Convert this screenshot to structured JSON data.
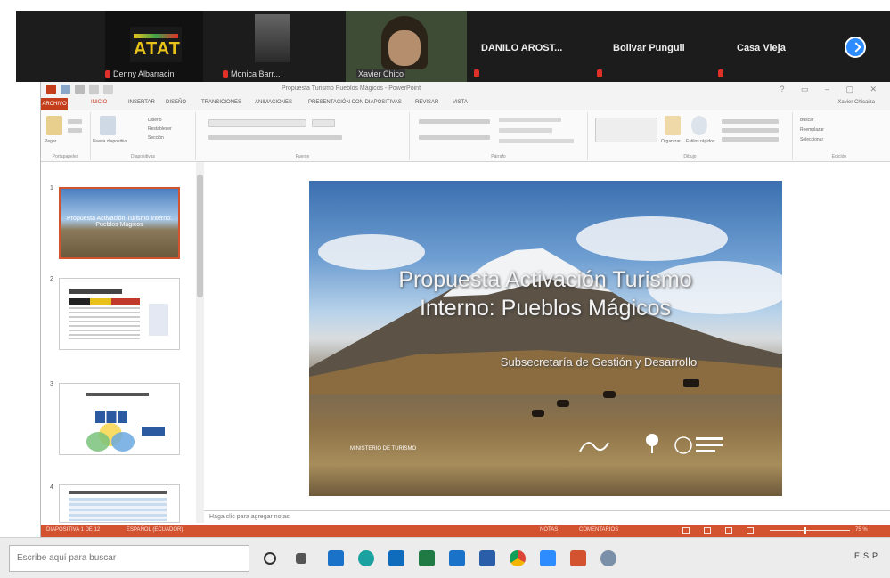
{
  "zoom": {
    "participants": [
      {
        "name": "Denny Albarracin",
        "kind": "logo"
      },
      {
        "name": "Monica Barr...",
        "kind": "video"
      },
      {
        "name": "Xavier Chico",
        "kind": "video"
      },
      {
        "name": "DANILO AROST...",
        "kind": "name"
      },
      {
        "name": "Bolivar Punguil",
        "kind": "name"
      },
      {
        "name": "Casa Vieja",
        "kind": "name"
      }
    ],
    "logo_text": "ATAT",
    "colors": {
      "bar": "#1c1c1c",
      "mic_muted": "#e0302a",
      "next": "#2d8cff"
    }
  },
  "ppt": {
    "doc_title": "Propuesta Turismo Pueblos Mágicos - PowerPoint",
    "file_tab": "ARCHIVO",
    "tabs": [
      "INICIO",
      "INSERTAR",
      "DISEÑO",
      "TRANSICIONES",
      "ANIMACIONES",
      "PRESENTACIÓN CON DIAPOSITIVAS",
      "REVISAR",
      "VISTA"
    ],
    "active_tab": "INICIO",
    "user": "Xavier Chicaiza",
    "ribbon_groups": [
      "Portapapeles",
      "Diapositivas",
      "Fuente",
      "Párrafo",
      "Dibujo",
      "Edición"
    ],
    "ribbon_labels": {
      "paste": "Pegar",
      "new_slide": "Nueva diapositiva",
      "design": "Diseño",
      "reset": "Restablecer",
      "section": "Sección",
      "arrange": "Organizar",
      "quick_styles": "Estilos rápidos",
      "find": "Buscar",
      "replace": "Reemplazar",
      "select": "Seleccionar"
    },
    "thumbnails": [
      {
        "num": "1",
        "title": "Propuesta Activación Turismo Interno: Pueblos Mágicos"
      },
      {
        "num": "2",
        "title": ""
      },
      {
        "num": "3",
        "title": ""
      },
      {
        "num": "4",
        "title": ""
      }
    ],
    "slide": {
      "title_line1": "Propuesta Activación Turismo",
      "title_line2": "Interno: Pueblos Mágicos",
      "subtitle": "Subsecretaría de Gestión y Desarrollo",
      "footer": "MINISTERIO DE TURISMO"
    },
    "notes_placeholder": "Haga clic para agregar notas",
    "status": {
      "slide_info": "DIAPOSITIVA 1 DE 12",
      "language": "ESPAÑOL (ECUADOR)",
      "notes": "NOTAS",
      "comments": "COMENTARIOS",
      "zoom": "75 %"
    },
    "colors": {
      "accent": "#d35230",
      "file_tab": "#c43e1c"
    }
  },
  "taskbar": {
    "search_placeholder": "Escribe aquí para buscar",
    "apps": [
      "search-icon",
      "task-view-icon",
      "file-explorer-icon",
      "edge-icon",
      "outlook-icon",
      "excel-icon",
      "store-icon",
      "mail-icon",
      "chrome-icon",
      "zoom-icon",
      "powerpoint-icon",
      "paint-icon"
    ],
    "tray_text": "ESP"
  }
}
